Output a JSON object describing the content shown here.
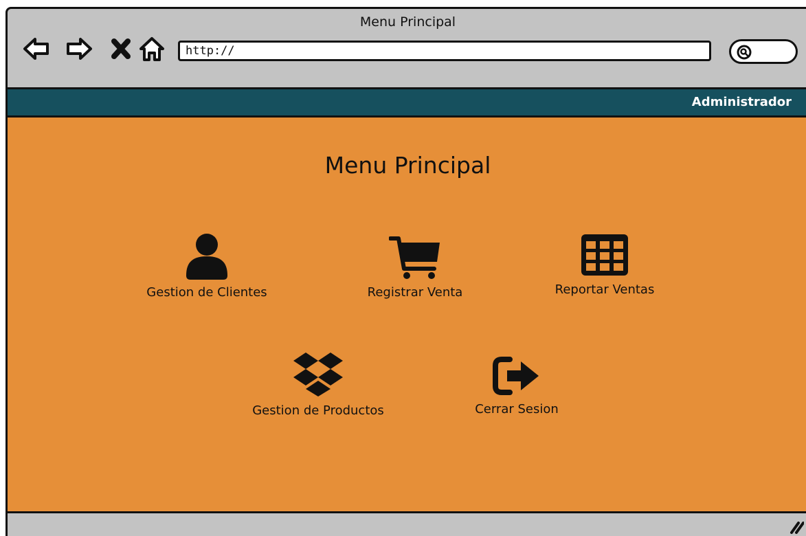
{
  "browser": {
    "window_title": "Menu Principal",
    "url": "http://",
    "buttons": {
      "back_icon": "arrow-left-icon",
      "forward_icon": "arrow-right-icon",
      "stop_icon": "close-icon",
      "home_icon": "home-icon",
      "search_icon": "search-icon"
    }
  },
  "header": {
    "user": "Administrador",
    "bar_color": "#16505e"
  },
  "main": {
    "title": "Menu Principal",
    "background_color": "#e68f38",
    "items": [
      {
        "label": "Gestion de Clientes",
        "icon": "user-icon"
      },
      {
        "label": "Registrar Venta",
        "icon": "shopping-cart-icon"
      },
      {
        "label": "Reportar Ventas",
        "icon": "table-icon"
      },
      {
        "label": "Gestion de Productos",
        "icon": "dropbox-icon"
      },
      {
        "label": "Cerrar Sesion",
        "icon": "sign-out-icon"
      }
    ]
  }
}
